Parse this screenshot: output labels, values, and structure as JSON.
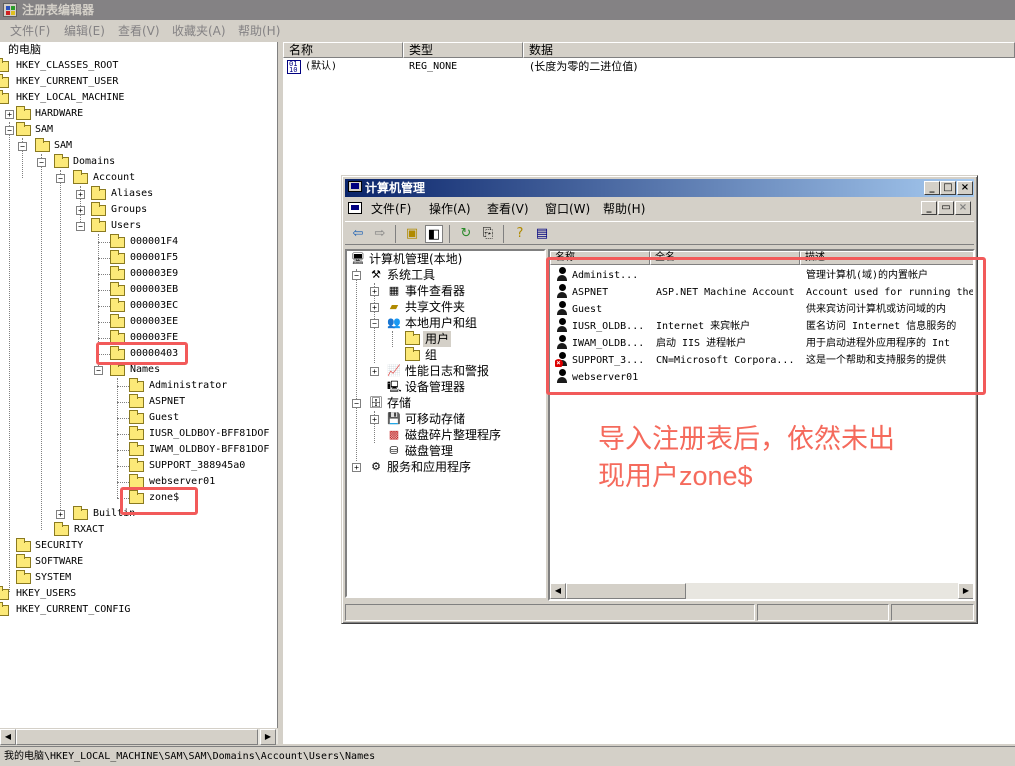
{
  "registry_editor": {
    "title": "注册表编辑器",
    "menu": [
      "文件(F)",
      "编辑(E)",
      "查看(V)",
      "收藏夹(A)",
      "帮助(H)"
    ],
    "tree": [
      {
        "label": "的电脑",
        "depth": 0
      },
      {
        "label": "HKEY_CLASSES_ROOT",
        "depth": 0
      },
      {
        "label": "HKEY_CURRENT_USER",
        "depth": 0
      },
      {
        "label": "HKEY_LOCAL_MACHINE",
        "depth": 0
      },
      {
        "label": "HARDWARE",
        "depth": 1
      },
      {
        "label": "SAM",
        "depth": 1
      },
      {
        "label": "SAM",
        "depth": 2
      },
      {
        "label": "Domains",
        "depth": 3
      },
      {
        "label": "Account",
        "depth": 4
      },
      {
        "label": "Aliases",
        "depth": 5
      },
      {
        "label": "Groups",
        "depth": 5
      },
      {
        "label": "Users",
        "depth": 5
      },
      {
        "label": "000001F4",
        "depth": 6
      },
      {
        "label": "000001F5",
        "depth": 6
      },
      {
        "label": "000003E9",
        "depth": 6
      },
      {
        "label": "000003EB",
        "depth": 6
      },
      {
        "label": "000003EC",
        "depth": 6
      },
      {
        "label": "000003EE",
        "depth": 6
      },
      {
        "label": "000003FE",
        "depth": 6
      },
      {
        "label": "00000403",
        "depth": 6
      },
      {
        "label": "Names",
        "depth": 6
      },
      {
        "label": "Administrator",
        "depth": 7
      },
      {
        "label": "ASPNET",
        "depth": 7
      },
      {
        "label": "Guest",
        "depth": 7
      },
      {
        "label": "IUSR_OLDBOY-BFF81DOF",
        "depth": 7
      },
      {
        "label": "IWAM_OLDBOY-BFF81DOF",
        "depth": 7
      },
      {
        "label": "SUPPORT_388945a0",
        "depth": 7
      },
      {
        "label": "webserver01",
        "depth": 7
      },
      {
        "label": "zone$",
        "depth": 7
      },
      {
        "label": "Builtin",
        "depth": 4
      },
      {
        "label": "RXACT",
        "depth": 3
      },
      {
        "label": "SECURITY",
        "depth": 1
      },
      {
        "label": "SOFTWARE",
        "depth": 1
      },
      {
        "label": "SYSTEM",
        "depth": 1
      },
      {
        "label": "HKEY_USERS",
        "depth": 0
      },
      {
        "label": "HKEY_CURRENT_CONFIG",
        "depth": 0
      }
    ],
    "columns": {
      "name": "名称",
      "type": "类型",
      "data": "数据"
    },
    "values": [
      {
        "name": "(默认)",
        "type": "REG_NONE",
        "data": "(长度为零的二进位值)"
      }
    ],
    "status_path": "我的电脑\\HKEY_LOCAL_MACHINE\\SAM\\SAM\\Domains\\Account\\Users\\Names"
  },
  "computer_management": {
    "title": "计算机管理",
    "menu": [
      "文件(F)",
      "操作(A)",
      "查看(V)",
      "窗口(W)",
      "帮助(H)"
    ],
    "tree": [
      {
        "label": "计算机管理(本地)",
        "icon": "computer-icon"
      },
      {
        "label": "系统工具",
        "icon": "tools-icon"
      },
      {
        "label": "事件查看器",
        "icon": "event-viewer-icon"
      },
      {
        "label": "共享文件夹",
        "icon": "shared-folder-icon"
      },
      {
        "label": "本地用户和组",
        "icon": "users-groups-icon"
      },
      {
        "label": "用户",
        "icon": "folder-open-icon"
      },
      {
        "label": "组",
        "icon": "folder-icon"
      },
      {
        "label": "性能日志和警报",
        "icon": "performance-icon"
      },
      {
        "label": "设备管理器",
        "icon": "device-manager-icon"
      },
      {
        "label": "存储",
        "icon": "storage-icon"
      },
      {
        "label": "可移动存储",
        "icon": "removable-storage-icon"
      },
      {
        "label": "磁盘碎片整理程序",
        "icon": "defrag-icon"
      },
      {
        "label": "磁盘管理",
        "icon": "disk-management-icon"
      },
      {
        "label": "服务和应用程序",
        "icon": "services-icon"
      }
    ],
    "list_columns": [
      "名称",
      "全名",
      "描述"
    ],
    "users": [
      {
        "name": "Administ...",
        "fullname": "",
        "description": "管理计算机(域)的内置帐户",
        "disabled": false
      },
      {
        "name": "ASPNET",
        "fullname": "ASP.NET Machine Account",
        "description": "Account used for running the",
        "disabled": false
      },
      {
        "name": "Guest",
        "fullname": "",
        "description": "供来宾访问计算机或访问域的内",
        "disabled": false
      },
      {
        "name": "IUSR_OLDB...",
        "fullname": "Internet 来宾帐户",
        "description": "匿名访问 Internet 信息服务的",
        "disabled": false
      },
      {
        "name": "IWAM_OLDB...",
        "fullname": "启动 IIS 进程帐户",
        "description": "用于启动进程外应用程序的 Int",
        "disabled": false
      },
      {
        "name": "SUPPORT_3...",
        "fullname": "CN=Microsoft Corpora...",
        "description": "这是一个帮助和支持服务的提供",
        "disabled": true
      },
      {
        "name": "webserver01",
        "fullname": "",
        "description": "",
        "disabled": false
      }
    ]
  },
  "annotation": {
    "line1": "导入注册表后，依然未出",
    "line2": "现用户zone$",
    "color": "#f56a5c"
  }
}
